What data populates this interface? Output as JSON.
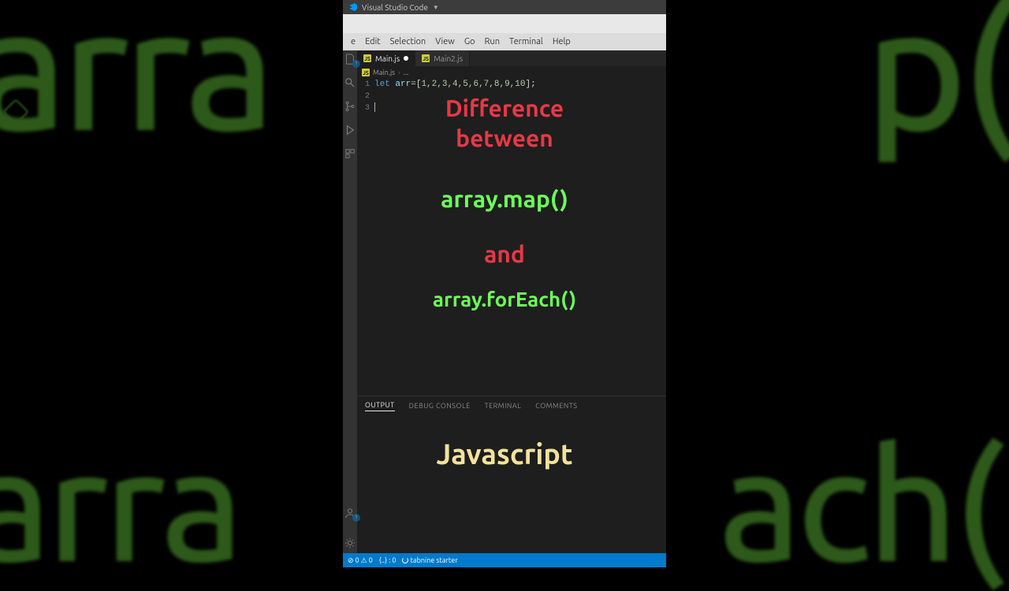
{
  "titlebar": {
    "title": "Visual Studio Code"
  },
  "menu": {
    "items": [
      "e",
      "Edit",
      "Selection",
      "View",
      "Go",
      "Run",
      "Terminal",
      "Help"
    ]
  },
  "tabs": [
    {
      "label": "Main.js",
      "active": true,
      "dirty": true
    },
    {
      "label": "Main2.js",
      "active": false,
      "dirty": false
    }
  ],
  "breadcrumb": {
    "file": "Main.js",
    "part2": "..."
  },
  "editor": {
    "line_numbers": [
      "1",
      "2",
      "3"
    ],
    "keyword": "let",
    "varname": "arr",
    "equals": "=",
    "open": "[",
    "values": "1,2,3,4,5,6,7,8,9,10",
    "close": "];"
  },
  "panel": {
    "tabs": [
      "OUTPUT",
      "DEBUG CONSOLE",
      "TERMINAL",
      "COMMENTS"
    ],
    "active": 0
  },
  "statusbar": {
    "errors": "0",
    "warnings": "0",
    "bracket": "{..} : 0",
    "tabnine": "tabnine starter"
  },
  "overlay": {
    "line1": "Difference",
    "line2": "between",
    "line3": "array.map()",
    "line4": "and",
    "line5": "array.forEach()",
    "line6": "Javascript"
  },
  "bg": {
    "tl": "arra",
    "tr": "p()",
    "bl": "arra",
    "br": "ach()"
  }
}
